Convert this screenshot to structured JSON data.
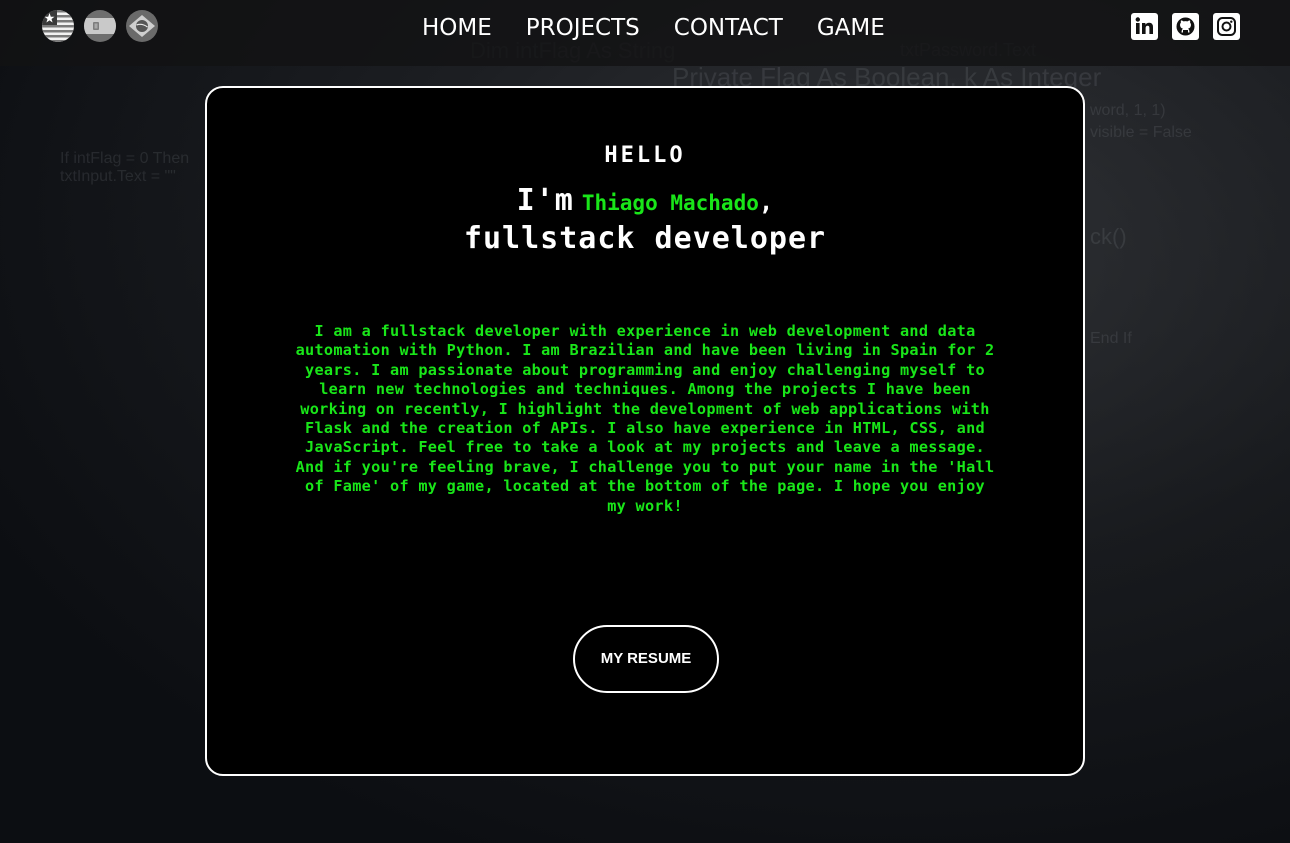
{
  "navbar": {
    "languages": [
      {
        "name": "English"
      },
      {
        "name": "Spanish"
      },
      {
        "name": "Portuguese"
      }
    ],
    "links": [
      {
        "label": "HOME"
      },
      {
        "label": "PROJECTS"
      },
      {
        "label": "CONTACT"
      },
      {
        "label": "GAME"
      }
    ],
    "socials": [
      {
        "icon": "linkedin-icon"
      },
      {
        "icon": "github-icon"
      },
      {
        "icon": "instagram-icon"
      }
    ]
  },
  "hero": {
    "greeting": "HELLO",
    "intro": "I'm",
    "name": "Thiago Machado",
    "comma": ",",
    "role": "fullstack developer",
    "about": "I am a fullstack developer with experience in web development and data automation with Python. I am Brazilian and have been living in Spain for 2 years. I am passionate about programming and enjoy challenging myself to learn new technologies and techniques. Among the projects I have been working on recently, I highlight the development of web applications with Flask and the creation of APIs. I also have experience in HTML, CSS, and JavaScript. Feel free to take a look at my projects and leave a message. And if you're feeling brave, I challenge you to put your name in the 'Hall of Fame' of my game, located at the bottom of the page. I hope you enjoy my work!",
    "resume_button": "MY RESUME"
  },
  "colors": {
    "accent_green": "#19e619",
    "text_white": "#ffffff",
    "card_bg": "#000000"
  }
}
